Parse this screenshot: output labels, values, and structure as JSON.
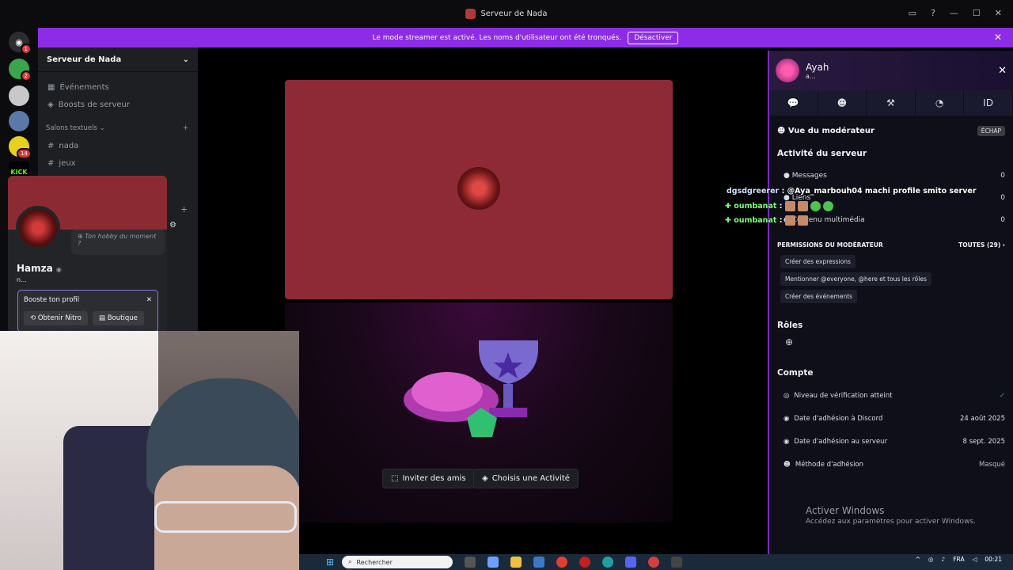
{
  "window": {
    "title": "Serveur de Nada"
  },
  "banner": {
    "text": "Le mode streamer est activé. Les noms d'utilisateur ont été tronqués.",
    "button": "Désactiver"
  },
  "rail": {
    "badges": [
      "1",
      "2",
      "14"
    ],
    "kick_label": "KICK"
  },
  "sidebar": {
    "server_name": "Serveur de Nada",
    "items": [
      {
        "label": "Événements"
      },
      {
        "label": "Boosts de serveur"
      }
    ],
    "category": "Salons textuels",
    "channels": [
      {
        "label": "nada"
      },
      {
        "label": "jeux"
      }
    ]
  },
  "profile_popout": {
    "hobby": "Ton hobby du moment ?",
    "name": "Hamza",
    "handle": "n...",
    "boost_title": "Booste ton profil",
    "nitro_button": "Obtenir Nitro",
    "shop_button": "Boutique"
  },
  "activity": {
    "invite_button": "Inviter des amis",
    "choose_button": "Choisis une Activité"
  },
  "panel": {
    "user_name": "Ayah",
    "user_handle": "a...",
    "mod_view": "Vue du modérateur",
    "esc_chip": "ÉCHAP",
    "server_activity": "Activité du serveur",
    "stats": [
      {
        "label": "Messages",
        "value": "0"
      },
      {
        "label": "Liens",
        "value": "0"
      },
      {
        "label": "Contenu multimédia",
        "value": "0"
      }
    ],
    "permissions_title": "PERMISSIONS DU MODÉRATEUR",
    "permissions_all": "TOUTES (29)",
    "permissions": [
      "Créer des expressions",
      "Mentionner @everyone, @here et tous les rôles",
      "Créer des événements"
    ],
    "roles_title": "Rôles",
    "account_title": "Compte",
    "account": [
      {
        "label": "Niveau de vérification atteint",
        "value": "✓"
      },
      {
        "label": "Date d'adhésion à Discord",
        "value": "24 août 2025"
      },
      {
        "label": "Date d'adhésion au serveur",
        "value": "8 sept. 2025"
      },
      {
        "label": "Méthode d'adhésion",
        "value": "Masqué"
      }
    ]
  },
  "watermark": {
    "title": "Activer Windows",
    "subtitle": "Accédez aux paramètres pour activer Windows."
  },
  "chat_overlay": [
    {
      "user": "dgsdgreerer",
      "message": ": @Aya_marbouh04 machi profile smito server"
    },
    {
      "user": "oumbanat",
      "message": ":"
    },
    {
      "user": "oumbanat",
      "message": ":"
    }
  ],
  "taskbar": {
    "search_placeholder": "Rechercher",
    "lang": "FRA",
    "time": "00:21"
  }
}
